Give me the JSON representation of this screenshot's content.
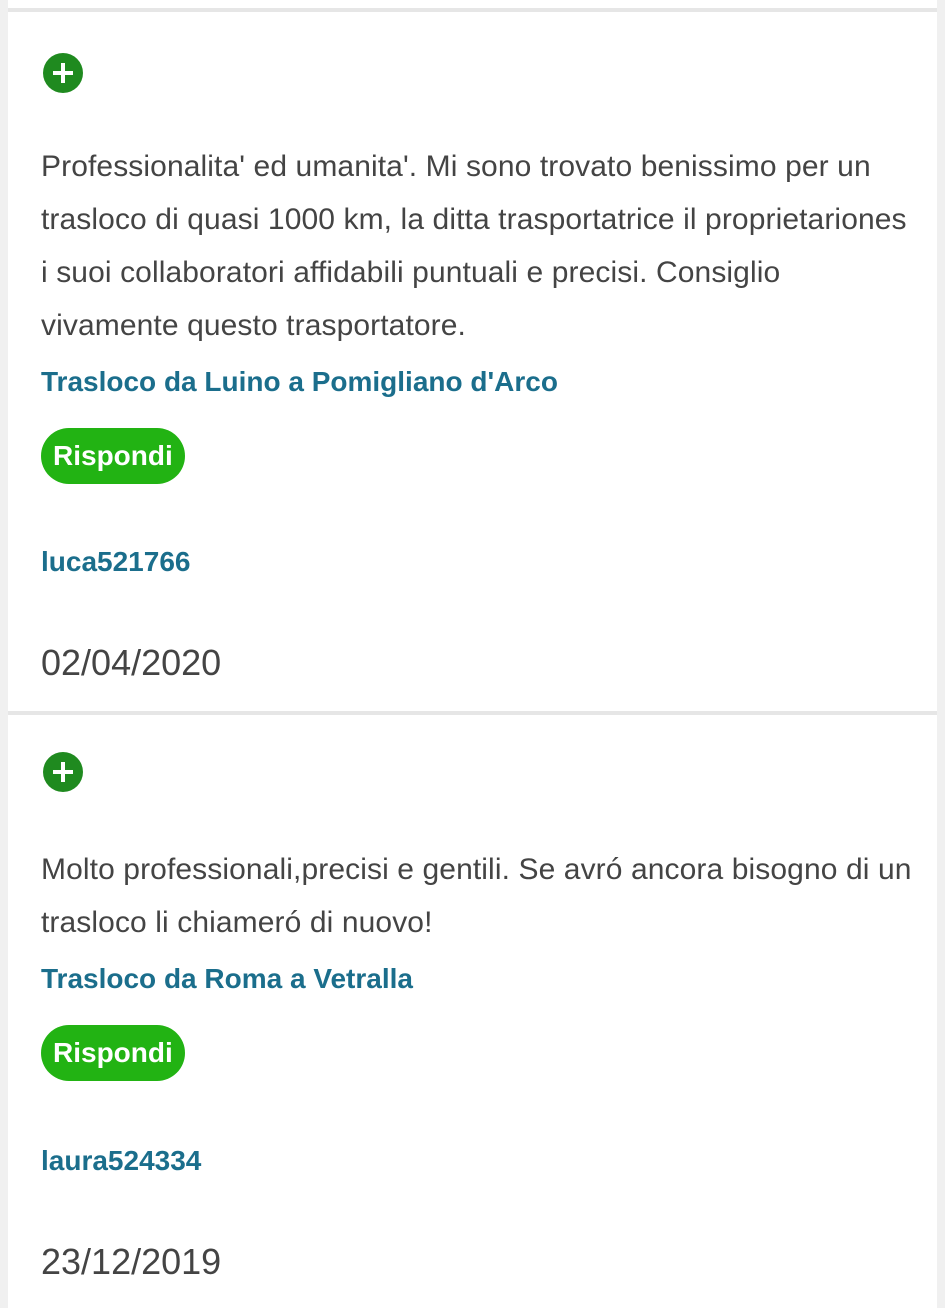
{
  "reviews": [
    {
      "expand_icon": "plus-circle-icon",
      "text": "Professionalita' ed umanita'. Mi sono trovato benissimo per un trasloco di quasi 1000 km, la ditta trasportatrice il proprietariones i suoi collaboratori affidabili puntuali e precisi. Consiglio vivamente questo trasportatore.",
      "route": "Trasloco da Luino a Pomigliano d'Arco",
      "reply_label": "Rispondi",
      "author": "luca521766",
      "date": "02/04/2020"
    },
    {
      "expand_icon": "plus-circle-icon",
      "text": "Molto professionali,precisi e gentili. Se avró ancora bisogno di un trasloco li chiameró di nuovo!",
      "route": "Trasloco da Roma a Vetralla",
      "reply_label": "Rispondi",
      "author": "laura524334",
      "date": "23/12/2019"
    }
  ],
  "colors": {
    "expand_icon": "#1f8a1f",
    "reply_button": "#22b313",
    "link": "#1b6e8c",
    "text": "#444444",
    "divider": "#e6e6e6"
  }
}
